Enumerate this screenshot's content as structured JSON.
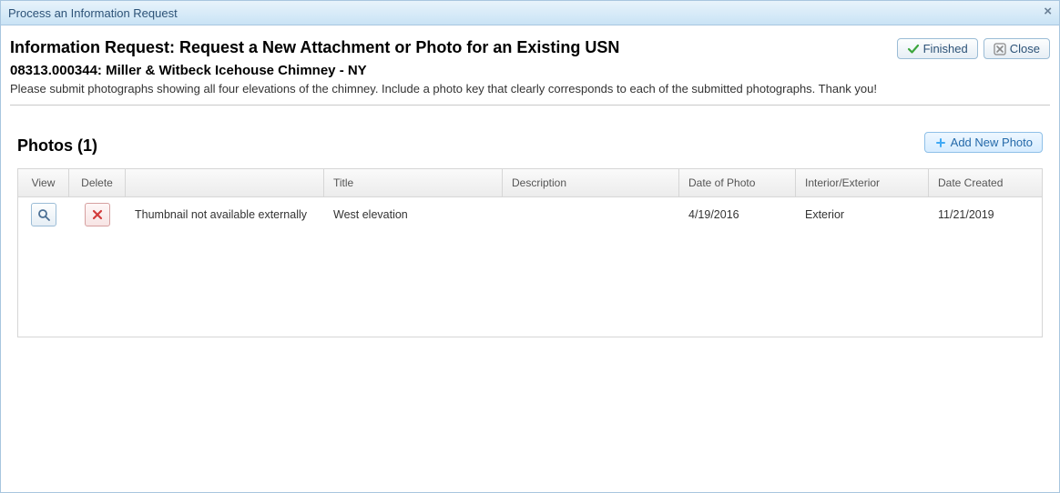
{
  "window": {
    "title": "Process an Information Request"
  },
  "header": {
    "title": "Information Request: Request a New Attachment or Photo for an Existing USN",
    "subtitle": "08313.000344: Miller & Witbeck Icehouse Chimney - NY",
    "instructions": "Please submit photographs showing all four elevations of the chimney. Include a photo key that clearly corresponds to each of the submitted photographs. Thank you!",
    "buttons": {
      "finished": "Finished",
      "close": "Close"
    }
  },
  "photos": {
    "section_title": "Photos (1)",
    "add_button": "Add New Photo",
    "columns": {
      "view": "View",
      "delete": "Delete",
      "thumb": "",
      "title": "Title",
      "description": "Description",
      "date_of_photo": "Date of Photo",
      "interior_exterior": "Interior/Exterior",
      "date_created": "Date Created"
    },
    "rows": [
      {
        "thumb": "Thumbnail not available externally",
        "title": "West elevation",
        "description": "",
        "date_of_photo": "4/19/2016",
        "interior_exterior": "Exterior",
        "date_created": "11/21/2019"
      }
    ]
  }
}
